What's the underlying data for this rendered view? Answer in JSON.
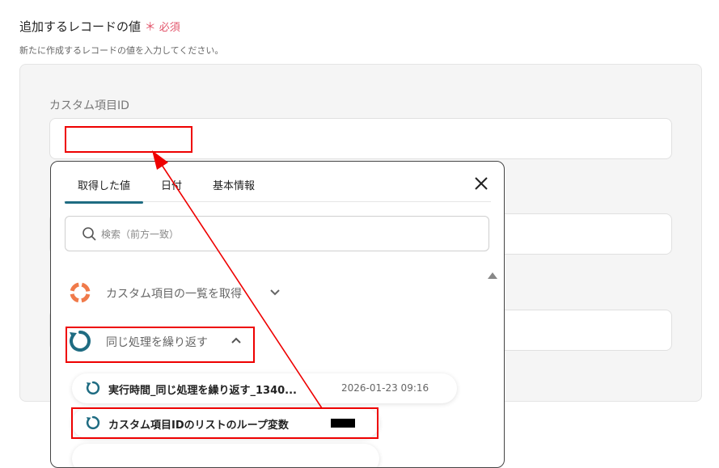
{
  "section": {
    "title": "追加するレコードの値",
    "required_mark": "＊",
    "required_label": "必須",
    "description": "新たに作成するレコードの値を入力してください。"
  },
  "field": {
    "label": "カスタム項目ID",
    "value": ""
  },
  "popup": {
    "tabs": [
      {
        "label": "取得した値",
        "active": true
      },
      {
        "label": "日付",
        "active": false
      },
      {
        "label": "基本情報",
        "active": false
      }
    ],
    "search_placeholder": "検索（前方一致）",
    "groups": [
      {
        "label": "カスタム項目の一覧を取得",
        "icon": "lifebuoy-icon",
        "expanded": false
      },
      {
        "label": "同じ処理を繰り返す",
        "icon": "loop-icon",
        "expanded": true
      }
    ],
    "items": [
      {
        "label": "実行時間_同じ処理を繰り返す_1340...",
        "date": "2026-01-23 09:16",
        "icon": "loop-icon"
      },
      {
        "label": "カスタム項目IDのリストのループ変数",
        "icon": "loop-icon"
      }
    ]
  },
  "colors": {
    "accent": "#1f6c82",
    "required": "#e2556b",
    "annotation": "#e00000"
  }
}
